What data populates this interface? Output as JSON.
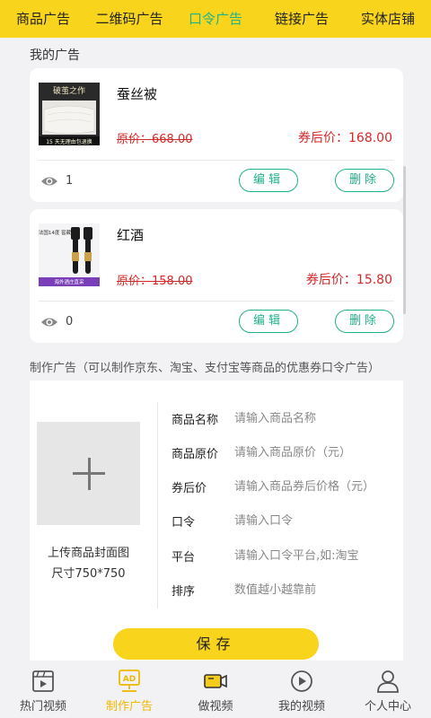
{
  "top_tabs": [
    {
      "label": "商品广告"
    },
    {
      "label": "二维码广告"
    },
    {
      "label": "口令广告"
    },
    {
      "label": "链接广告"
    },
    {
      "label": "实体店铺"
    }
  ],
  "active_tab": 2,
  "my_ads_title": "我的广告",
  "ads": [
    {
      "name": "蚕丝被",
      "original_price": "原价：668.00",
      "coupon_price": "券后价：168.00",
      "views": "1",
      "edit_label": "编辑",
      "delete_label": "删除",
      "thumb_caption": "破茧之作",
      "thumb_tag": "15 天无理由包退换"
    },
    {
      "name": "红酒",
      "original_price": "原价：158.00",
      "coupon_price": "券后价：15.80",
      "views": "0",
      "edit_label": "编辑",
      "delete_label": "删除",
      "thumb_caption": "法国14度 窖藏",
      "thumb_tag": "海外酒庄直采"
    }
  ],
  "create_title": "制作广告（可以制作京东、淘宝、支付宝等商品的优惠券口令广告）",
  "upload": {
    "line1": "上传商品封面图",
    "line2": "尺寸750*750"
  },
  "form": [
    {
      "label": "商品名称",
      "placeholder": "请输入商品名称"
    },
    {
      "label": "商品原价",
      "placeholder": "请输入商品原价（元）"
    },
    {
      "label": "券后价",
      "placeholder": "请输入商品券后价格（元）"
    },
    {
      "label": "口令",
      "placeholder": "请输入口令"
    },
    {
      "label": "平台",
      "placeholder": "请输入口令平台,如:淘宝"
    },
    {
      "label": "排序",
      "placeholder": "数值越小越靠前"
    }
  ],
  "save_label": "保存",
  "bottom_nav": [
    {
      "label": "热门视频",
      "icon": "film-icon"
    },
    {
      "label": "制作广告",
      "icon": "ad-icon"
    },
    {
      "label": "做视频",
      "icon": "camera-icon"
    },
    {
      "label": "我的视频",
      "icon": "play-circle-icon"
    },
    {
      "label": "个人中心",
      "icon": "person-icon"
    }
  ],
  "colors": {
    "brand_yellow": "#f8d41c",
    "accent_green": "#1fb28a",
    "price_red": "#d62828"
  }
}
